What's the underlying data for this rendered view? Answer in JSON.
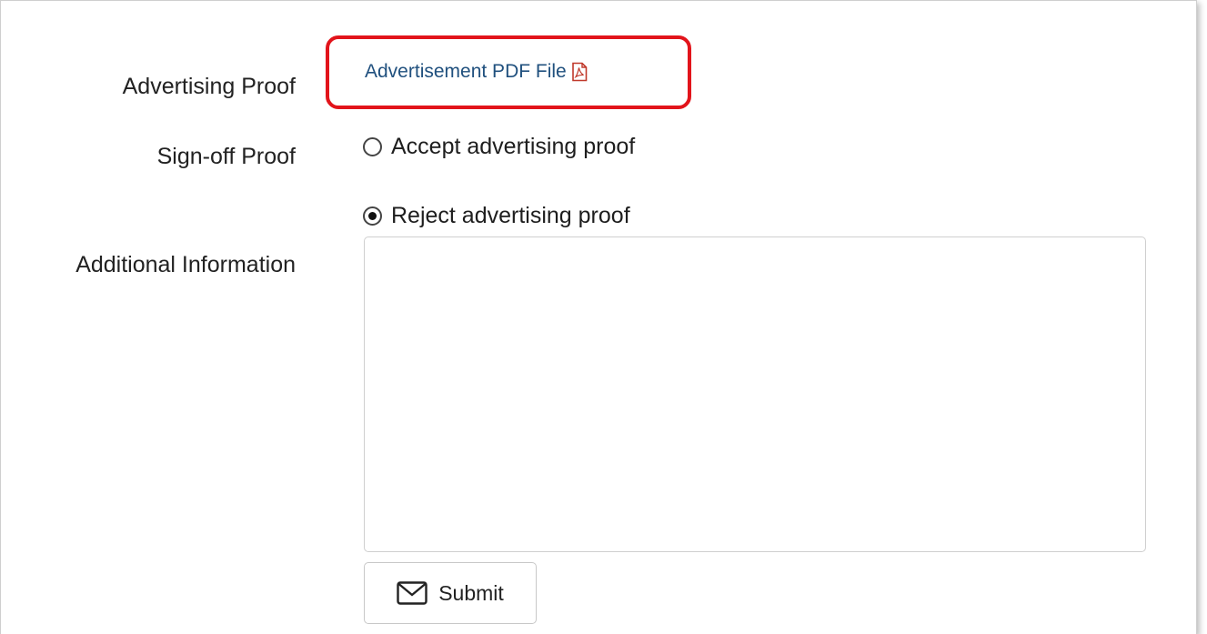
{
  "form": {
    "advertising_proof_label": "Advertising Proof",
    "pdf_link_text": "Advertisement PDF File",
    "pdf_icon": "pdf-file-icon",
    "sign_off_label": "Sign-off Proof",
    "options": [
      {
        "label": "Accept advertising proof",
        "checked": false
      },
      {
        "label": "Reject advertising proof",
        "checked": true
      }
    ],
    "additional_info_label": "Additional Information",
    "additional_info_value": "",
    "submit_label": "Submit",
    "submit_icon": "envelope-icon"
  },
  "colors": {
    "highlight_border": "#e2141b",
    "link": "#20507e",
    "pdf_icon": "#c0392b"
  }
}
